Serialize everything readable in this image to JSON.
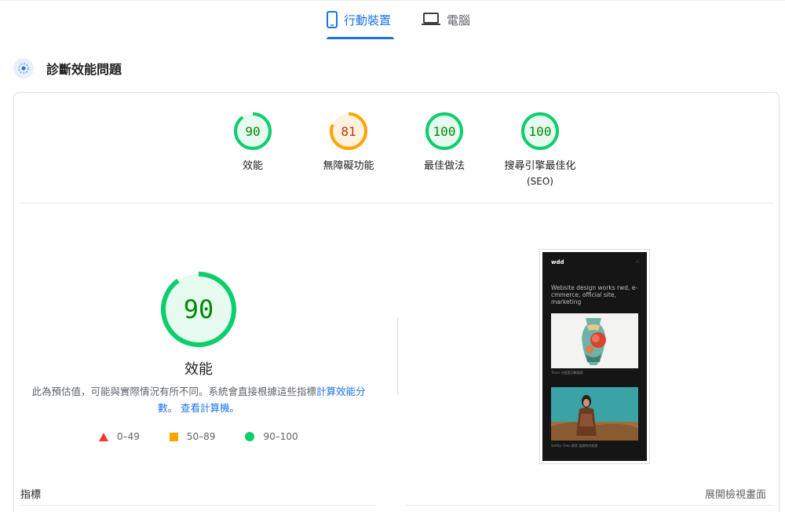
{
  "tabs": [
    {
      "label": "行動裝置",
      "icon": "smartphone-icon",
      "active": true
    },
    {
      "label": "電腦",
      "icon": "laptop-icon",
      "active": false
    }
  ],
  "diagnose": {
    "title": "診斷效能問題",
    "icon": "lighthouse-icon"
  },
  "categories": [
    {
      "score": "90",
      "label": "效能",
      "sub": "",
      "color": "#0cce6b",
      "text_color": "#008800",
      "bg": "#e6faf0",
      "value": 0.9
    },
    {
      "score": "81",
      "label": "無障礙功能",
      "sub": "",
      "color": "#ffa400",
      "text_color": "#c33300",
      "bg": "#fff3e0",
      "value": 0.81
    },
    {
      "score": "100",
      "label": "最佳做法",
      "sub": "",
      "color": "#0cce6b",
      "text_color": "#008800",
      "bg": "#e6faf0",
      "value": 1.0
    },
    {
      "score": "100",
      "label": "搜尋引擎最佳化",
      "sub": "(SEO)",
      "color": "#0cce6b",
      "text_color": "#008800",
      "bg": "#e6faf0",
      "value": 1.0
    }
  ],
  "performance": {
    "score": "90",
    "value": 0.9,
    "title": "效能",
    "desc_prefix": "此為預估值，可能與實際情況有所不同。系統會直接根據這些指標",
    "desc_link1": "計算效能分數",
    "desc_sep": "。",
    "desc_link2": "查看計算機",
    "desc_suffix": "。"
  },
  "legend": [
    {
      "shape": "triangle",
      "range": "0–49",
      "color": "#ff3333"
    },
    {
      "shape": "square",
      "range": "50–89",
      "color": "#ffa400"
    },
    {
      "shape": "circle",
      "range": "90–100",
      "color": "#0cce6b"
    }
  ],
  "screenshot": {
    "logo": "wdd",
    "menu": "∴",
    "heading": "Website design works rwd, e-cmmerce, official site, marketing",
    "caption1": "Travis 台藍藍回靴經銷",
    "caption2": "Smitty Chen 買家 溫度時尚經銷"
  },
  "footer": {
    "metrics_label": "指標",
    "expand_label": "展開檢視畫面"
  }
}
